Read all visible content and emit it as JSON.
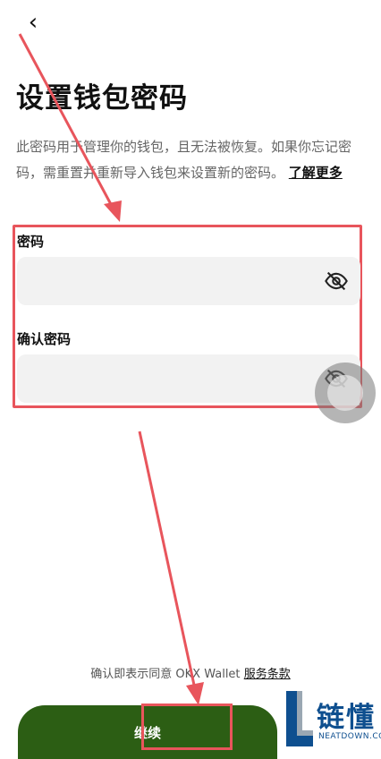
{
  "header": {
    "back_icon": "chevron-left-icon",
    "back_glyph": "‹"
  },
  "title": "设置钱包密码",
  "description": {
    "text": "此密码用于管理你的钱包，且无法被恢复。如果你忘记密码，需重置并重新导入钱包来设置新的密码。",
    "learn_more": "了解更多"
  },
  "form": {
    "password_label": "密码",
    "password_value": "",
    "confirm_label": "确认密码",
    "confirm_value": "",
    "eye_icon": "eye-off-icon"
  },
  "footer": {
    "agree_text": "确认即表示同意 OKX Wallet",
    "terms_link": "服务条款",
    "continue_label": "继续"
  },
  "watermark": {
    "brand": "链懂",
    "domain": "NEATDOWN.COM"
  },
  "colors": {
    "accent": "#2c5e14",
    "highlight": "#e8555c",
    "field_bg": "#f2f2f2"
  }
}
